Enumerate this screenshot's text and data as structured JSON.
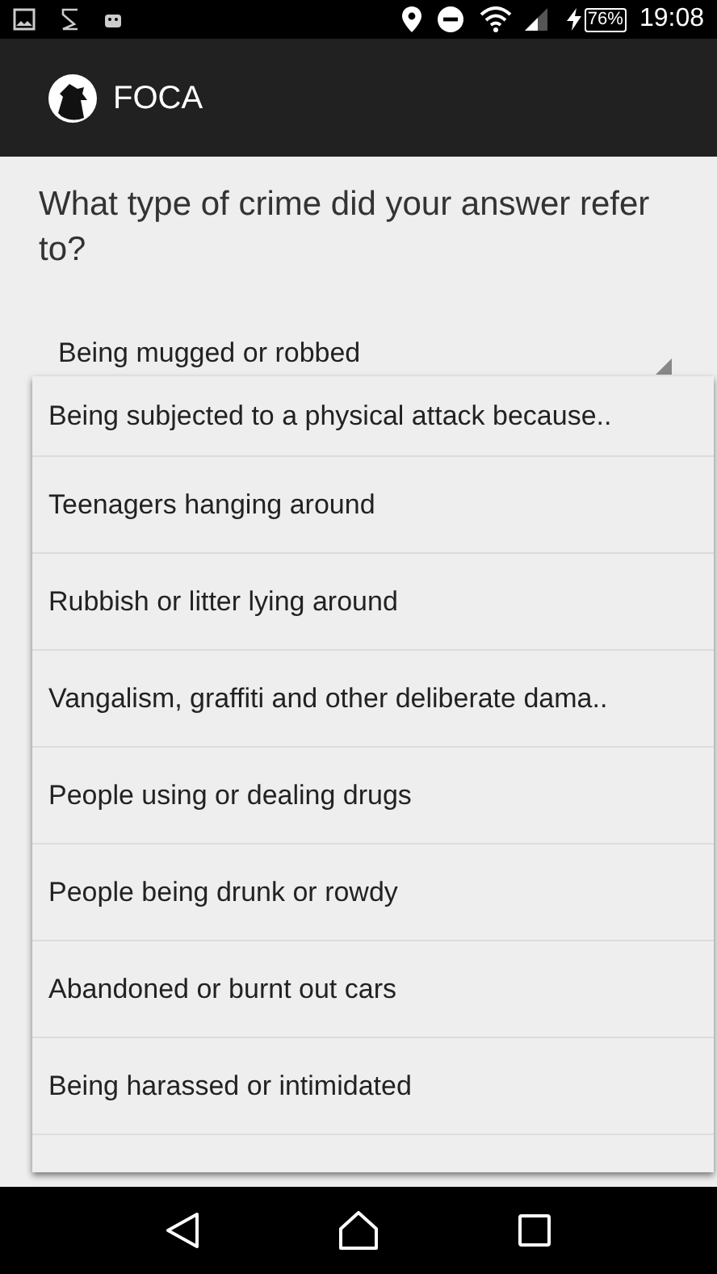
{
  "status_bar": {
    "battery": "76%",
    "time": "19:08"
  },
  "app_bar": {
    "title": "FOCA"
  },
  "question": "What type of crime did your answer refer to?",
  "spinner": {
    "value": "Being mugged or robbed",
    "expanded": true
  },
  "options": [
    {
      "label": "Being subjected to a physical attack because.."
    },
    {
      "label": "Teenagers hanging around"
    },
    {
      "label": "Rubbish or litter lying around"
    },
    {
      "label": "Vangalism, graffiti and other deliberate dama.."
    },
    {
      "label": "People using or dealing drugs"
    },
    {
      "label": "People being drunk or rowdy"
    },
    {
      "label": "Abandoned or burnt out cars"
    },
    {
      "label": "Being harassed or intimidated"
    }
  ]
}
